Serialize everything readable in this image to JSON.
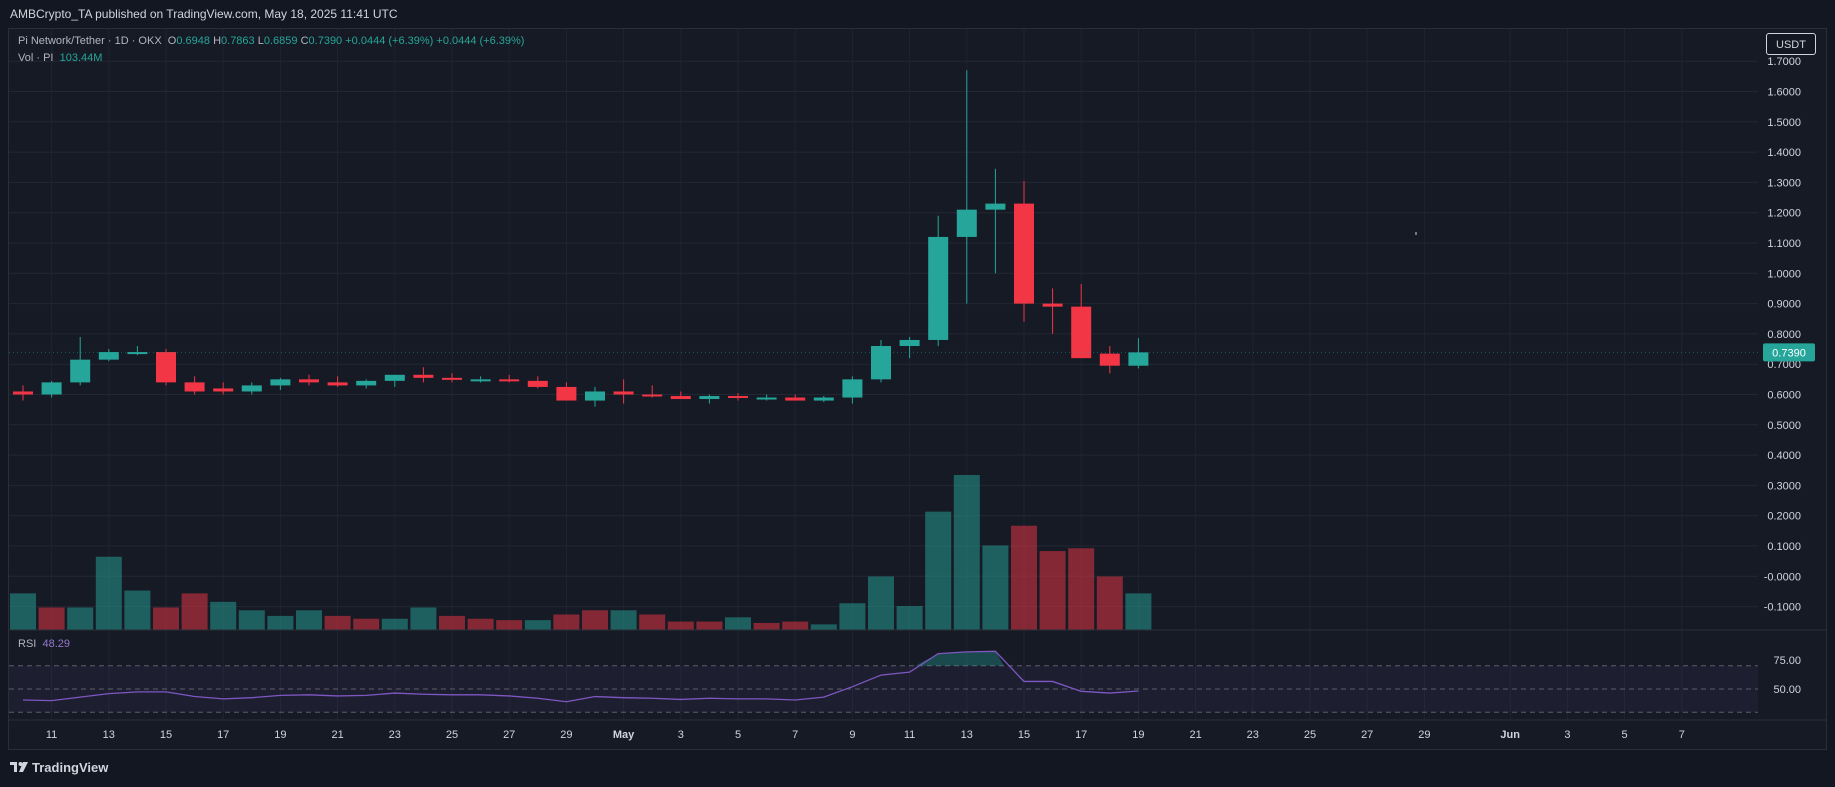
{
  "header": {
    "published": "AMBCrypto_TA published on TradingView.com, May 18, 2025 11:41 UTC"
  },
  "legend": {
    "symbol": "Pi Network/Tether · 1D · OKX",
    "o_label": "O",
    "o_value": "0.6948",
    "h_label": "H",
    "h_value": "0.7863",
    "l_label": "L",
    "l_value": "0.6859",
    "c_label": "C",
    "c_value": "0.7390",
    "change1": "+0.0444 (+6.39%)",
    "change2": "+0.0444 (+6.39%)",
    "vol_label": "Vol · PI",
    "vol_value": "103.44M"
  },
  "currency_button": "USDT",
  "rsi": {
    "label": "RSI",
    "value": "48.29"
  },
  "footer": {
    "brand": "TradingView"
  },
  "colors": {
    "up": "#26a69a",
    "down": "#f23645",
    "rsi_line": "#7e57c2",
    "background": "#161a25"
  },
  "chart_data": [
    {
      "type": "candlestick",
      "title": "Pi Network/Tether · 1D · OKX",
      "x_tick_labels": [
        "11",
        "13",
        "15",
        "17",
        "19",
        "21",
        "23",
        "25",
        "27",
        "29",
        "May",
        "3",
        "5",
        "7",
        "9",
        "11",
        "13",
        "15",
        "17",
        "19",
        "21",
        "23",
        "25",
        "27",
        "29",
        "Jun",
        "3",
        "5",
        "7"
      ],
      "y_tick_labels": [
        "-0.1000",
        "-0.0000",
        "0.1000",
        "0.2000",
        "0.3000",
        "0.4000",
        "0.5000",
        "0.6000",
        "0.7000",
        "0.8000",
        "0.9000",
        "1.0000",
        "1.1000",
        "1.2000",
        "1.3000",
        "1.4000",
        "1.5000",
        "1.6000",
        "1.7000"
      ],
      "ylim": [
        -0.155,
        1.735
      ],
      "last_price_label": "0.7390",
      "x_dates": [
        "Apr 10",
        "Apr 11",
        "Apr 12",
        "Apr 13",
        "Apr 14",
        "Apr 15",
        "Apr 16",
        "Apr 17",
        "Apr 18",
        "Apr 19",
        "Apr 20",
        "Apr 21",
        "Apr 22",
        "Apr 23",
        "Apr 24",
        "Apr 25",
        "Apr 26",
        "Apr 27",
        "Apr 28",
        "Apr 29",
        "Apr 30",
        "May 1",
        "May 2",
        "May 3",
        "May 4",
        "May 5",
        "May 6",
        "May 7",
        "May 8",
        "May 9",
        "May 10",
        "May 11",
        "May 12",
        "May 13",
        "May 14",
        "May 15",
        "May 16",
        "May 17",
        "May 18"
      ],
      "open": [
        0.61,
        0.6,
        0.64,
        0.715,
        0.74,
        0.74,
        0.64,
        0.62,
        0.61,
        0.63,
        0.65,
        0.64,
        0.63,
        0.645,
        0.665,
        0.655,
        0.65,
        0.65,
        0.645,
        0.625,
        0.58,
        0.61,
        0.6,
        0.595,
        0.585,
        0.595,
        0.59,
        0.59,
        0.58,
        0.59,
        0.65,
        0.76,
        0.78,
        1.12,
        1.21,
        1.23,
        0.9,
        0.89,
        0.735,
        0.695
      ],
      "high": [
        0.63,
        0.645,
        0.79,
        0.75,
        0.76,
        0.75,
        0.66,
        0.64,
        0.64,
        0.655,
        0.665,
        0.66,
        0.65,
        0.66,
        0.69,
        0.67,
        0.66,
        0.665,
        0.66,
        0.64,
        0.625,
        0.65,
        0.63,
        0.61,
        0.6,
        0.605,
        0.6,
        0.6,
        0.595,
        0.66,
        0.78,
        0.79,
        1.19,
        1.67,
        1.345,
        1.305,
        0.95,
        0.965,
        0.76,
        0.786
      ],
      "low": [
        0.58,
        0.59,
        0.63,
        0.71,
        0.73,
        0.63,
        0.6,
        0.6,
        0.6,
        0.615,
        0.63,
        0.625,
        0.62,
        0.625,
        0.64,
        0.64,
        0.64,
        0.64,
        0.62,
        0.59,
        0.56,
        0.57,
        0.59,
        0.585,
        0.57,
        0.58,
        0.58,
        0.58,
        0.575,
        0.57,
        0.64,
        0.72,
        0.76,
        0.9,
        1.0,
        0.84,
        0.8,
        0.73,
        0.67,
        0.686
      ],
      "close": [
        0.6,
        0.64,
        0.715,
        0.74,
        0.74,
        0.64,
        0.61,
        0.61,
        0.63,
        0.65,
        0.64,
        0.63,
        0.645,
        0.665,
        0.655,
        0.65,
        0.65,
        0.645,
        0.625,
        0.58,
        0.61,
        0.6,
        0.595,
        0.585,
        0.595,
        0.59,
        0.59,
        0.58,
        0.59,
        0.65,
        0.76,
        0.78,
        1.12,
        1.21,
        1.23,
        0.9,
        0.89,
        0.72,
        0.695,
        0.739
      ],
      "volume_units": "relative (0-1)",
      "volume_up": [
        true,
        false,
        true,
        true,
        true,
        false,
        false,
        true,
        true,
        true,
        true,
        false,
        false,
        true,
        true,
        false,
        false,
        false,
        true,
        false,
        false,
        true,
        false,
        false,
        false,
        true,
        false,
        false,
        true,
        true,
        true,
        true,
        true,
        true,
        true,
        false,
        false,
        false,
        false,
        true
      ],
      "volume_values": [
        0.13,
        0.08,
        0.08,
        0.26,
        0.14,
        0.08,
        0.13,
        0.1,
        0.07,
        0.05,
        0.07,
        0.05,
        0.04,
        0.04,
        0.08,
        0.05,
        0.04,
        0.035,
        0.035,
        0.055,
        0.07,
        0.07,
        0.055,
        0.03,
        0.03,
        0.045,
        0.025,
        0.03,
        0.02,
        0.095,
        0.19,
        0.085,
        0.42,
        0.55,
        0.3,
        0.37,
        0.28,
        0.29,
        0.19,
        0.13
      ]
    },
    {
      "type": "line",
      "title": "RSI",
      "y_tick_labels": [
        "75.00",
        "50.00"
      ],
      "ylim": [
        20,
        90
      ],
      "bands": [
        70,
        50,
        30
      ],
      "values": [
        40.5,
        40.0,
        43.0,
        46.0,
        47.5,
        47.5,
        43.5,
        41.5,
        42.5,
        44.5,
        45.0,
        44.0,
        44.5,
        46.5,
        45.5,
        45.0,
        45.0,
        44.0,
        42.0,
        39.0,
        43.5,
        42.5,
        42.0,
        41.0,
        42.0,
        41.5,
        41.5,
        40.5,
        43.0,
        52.0,
        62.0,
        64.5,
        80.5,
        82.0,
        82.5,
        56.5,
        56.5,
        48.0,
        46.5,
        48.29
      ]
    }
  ]
}
